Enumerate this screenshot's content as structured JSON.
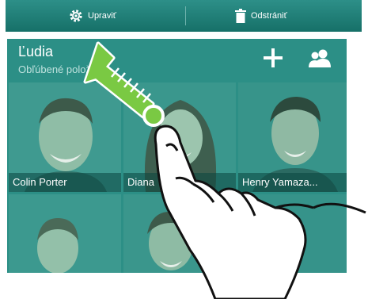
{
  "toolbar": {
    "edit_label": "Upraviť",
    "delete_label": "Odstrániť"
  },
  "header": {
    "title": "Ľudia",
    "subtitle": "Obľúbené položky"
  },
  "contacts": [
    {
      "name": "Colin Porter"
    },
    {
      "name": "Diana"
    },
    {
      "name": "Henry Yamaza..."
    },
    {
      "name": ""
    },
    {
      "name": ""
    },
    {
      "name": ""
    }
  ],
  "icons": {
    "edit": "gear-icon",
    "delete": "trash-icon",
    "add": "plus-icon",
    "groups": "people-icon"
  },
  "colors": {
    "accent": "#167068",
    "screen_bg": "#2c8f86",
    "arrow_green": "#7ac943"
  }
}
